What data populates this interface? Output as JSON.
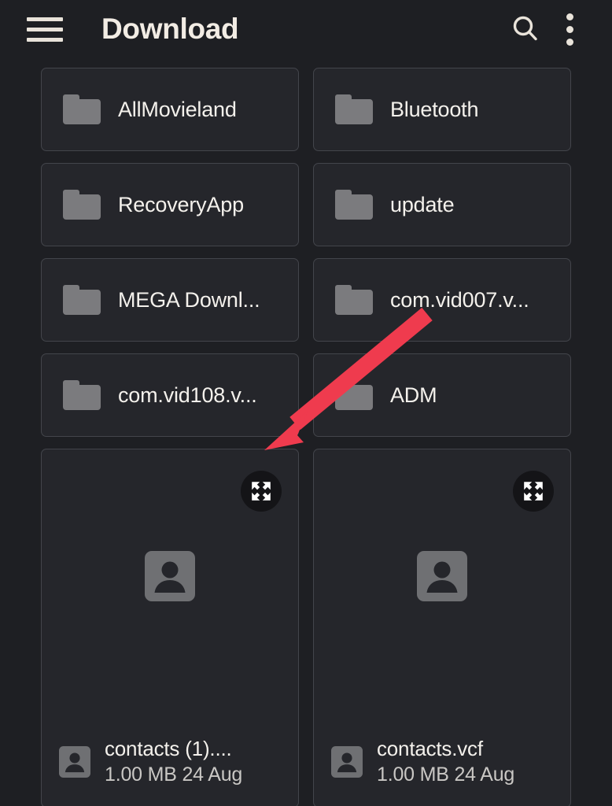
{
  "appbar": {
    "menu_icon": "hamburger-menu-icon",
    "title": "Download",
    "search_icon": "search-icon",
    "overflow_icon": "more-vertical-icon"
  },
  "grid": {
    "folders": [
      {
        "icon": "folder-icon",
        "label": "AllMovieland"
      },
      {
        "icon": "folder-icon",
        "label": "Bluetooth"
      },
      {
        "icon": "folder-icon",
        "label": "RecoveryApp"
      },
      {
        "icon": "folder-icon",
        "label": "update"
      },
      {
        "icon": "folder-icon",
        "label": "MEGA Downl..."
      },
      {
        "icon": "folder-icon",
        "label": "com.vid007.v..."
      },
      {
        "icon": "folder-icon",
        "label": "com.vid108.v..."
      },
      {
        "icon": "folder-icon",
        "label": "ADM"
      }
    ],
    "files": [
      {
        "icon": "contact-file-icon",
        "thumb_icon": "contact-placeholder-icon",
        "expand_icon": "expand-fullscreen-icon",
        "name": "contacts (1)....",
        "size": "1.00 MB",
        "date": "24 Aug",
        "sub": "1.00 MB 24 Aug"
      },
      {
        "icon": "contact-file-icon",
        "thumb_icon": "contact-placeholder-icon",
        "expand_icon": "expand-fullscreen-icon",
        "name": "contacts.vcf",
        "size": "1.00 MB",
        "date": "24 Aug",
        "sub": "1.00 MB 24 Aug"
      }
    ]
  },
  "annotation": {
    "arrow_icon": "red-pointer-arrow",
    "color": "#ef3b4e",
    "points_to": "expand-fullscreen-icon"
  },
  "colors": {
    "page_background": "#1e1f23",
    "card_background": "#25262b",
    "card_border": "#43454b",
    "title_text": "#f2ece4",
    "primary_text": "#f4f1ec",
    "secondary_text": "#c9c7c4",
    "icon_gray": "#7b7b7e",
    "annotation_red": "#ef3b4e"
  }
}
